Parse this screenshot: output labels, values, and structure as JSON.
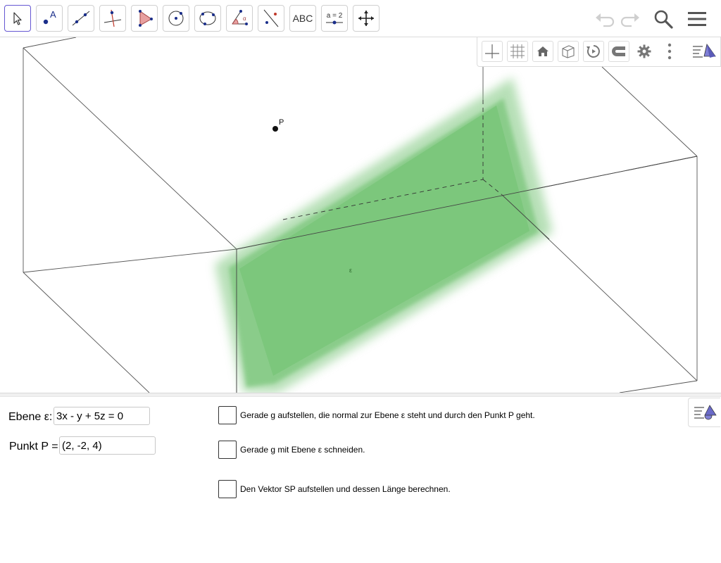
{
  "toolbar": {
    "tools": [
      {
        "name": "move-tool",
        "icon": "cursor-arrow-icon"
      },
      {
        "name": "point-tool",
        "icon": "point-icon",
        "label": "A"
      },
      {
        "name": "line-tool",
        "icon": "line-through-points-icon"
      },
      {
        "name": "perpendicular-line-tool",
        "icon": "perpendicular-line-icon"
      },
      {
        "name": "polygon-tool",
        "icon": "triangle-polygon-icon"
      },
      {
        "name": "circle-tool",
        "icon": "circle-center-point-icon"
      },
      {
        "name": "circle-three-points-tool",
        "icon": "circle-three-points-icon"
      },
      {
        "name": "angle-tool",
        "icon": "angle-icon"
      },
      {
        "name": "reflect-tool",
        "icon": "reflect-line-icon"
      },
      {
        "name": "text-tool",
        "icon": "text-icon",
        "label": "ABC"
      },
      {
        "name": "slider-tool",
        "icon": "slider-icon",
        "label": "a = 2"
      },
      {
        "name": "move-view-tool",
        "icon": "move-arrows-icon"
      }
    ],
    "right": [
      "undo-icon",
      "redo-icon",
      "search-icon",
      "menu-icon"
    ]
  },
  "style_bar": {
    "buttons": [
      "axes-icon",
      "grid-icon",
      "home-icon",
      "cube-icon",
      "rotate-icon",
      "magnet-icon",
      "gear-icon",
      "more-vert-icon",
      "style-bar-toggle-icon"
    ]
  },
  "graphics": {
    "point_label": "P",
    "plane_label": "ε",
    "plane_color": "#7bc67b"
  },
  "inputs": {
    "plane_label": "Ebene ε:",
    "plane_value": "3x - y + 5z = 0",
    "point_label": "Punkt P =",
    "point_value": "(2, -2, 4)"
  },
  "tasks": [
    {
      "label": "Gerade g aufstellen, die normal zur Ebene ε steht und durch den Punkt P geht.",
      "checked": false
    },
    {
      "label": "Gerade g mit Ebene ε schneiden.",
      "checked": false
    },
    {
      "label": "Den Vektor SP aufstellen und dessen Länge berechnen.",
      "checked": false
    }
  ]
}
